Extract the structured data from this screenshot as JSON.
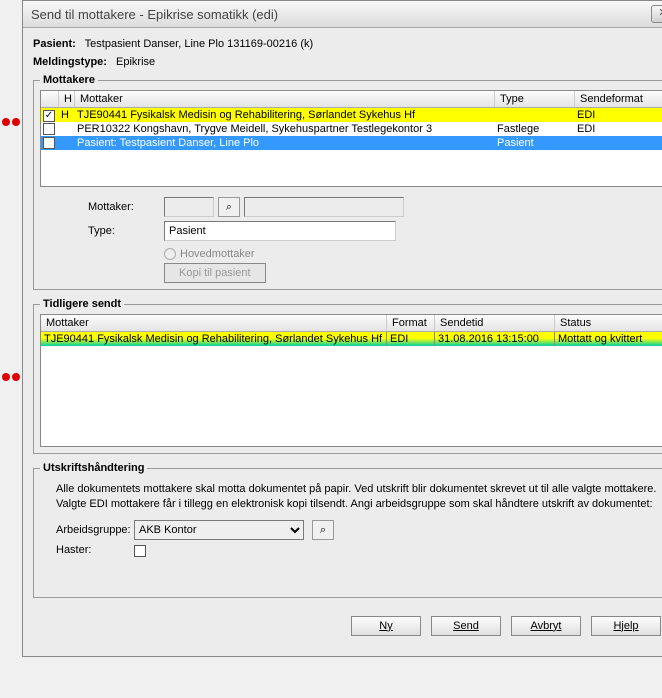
{
  "titlebar": {
    "title": "Send til mottakere - Epikrise somatikk (edi)"
  },
  "patient": {
    "label": "Pasient:",
    "value": "Testpasient Danser, Line Plo  131169-00216 (k)"
  },
  "msgtype": {
    "label": "Meldingstype:",
    "value": "Epikrise"
  },
  "recipients": {
    "legend": "Mottakere",
    "headers": {
      "h": "H",
      "mottaker": "Mottaker",
      "type": "Type",
      "format": "Sendeformat"
    },
    "rows": [
      {
        "checked": true,
        "h": "H",
        "code": "TJE90441",
        "name": "Fysikalsk Medisin og Rehabilitering, Sørlandet Sykehus Hf",
        "type": "",
        "format": "EDI",
        "hl": "yellow"
      },
      {
        "checked": false,
        "h": "",
        "code": "PER10322",
        "name": "Kongshavn, Trygve Meidell, Sykehuspartner Testlegekontor 3",
        "type": "Fastlege",
        "format": "EDI",
        "hl": ""
      },
      {
        "checked": false,
        "h": "",
        "code": "",
        "name": "Pasient: Testpasient Danser, Line Plo",
        "type": "Pasient",
        "format": "",
        "hl": "blue"
      }
    ],
    "form": {
      "mottaker_label": "Mottaker:",
      "type_label": "Type:",
      "type_value": "Pasient",
      "hovedmottaker_label": "Hovedmottaker",
      "kopi_btn": "Kopi til pasient"
    }
  },
  "sent": {
    "legend": "Tidligere sendt",
    "headers": {
      "mottaker": "Mottaker",
      "format": "Format",
      "sendetid": "Sendetid",
      "status": "Status"
    },
    "rows": [
      {
        "code": "TJE90441",
        "name": "Fysikalsk Medisin og Rehabilitering, Sørlandet Sykehus Hf",
        "format": "EDI",
        "time": "31.08.2016 13:15:00",
        "status": "Mottatt og kvittert"
      }
    ]
  },
  "printing": {
    "legend": "Utskriftshåndtering",
    "text": "Alle dokumentets mottakere skal motta dokumentet på papir. Ved utskrift blir dokumentet skrevet ut til alle valgte mottakere. Valgte EDI mottakere får i tillegg en elektronisk kopi tilsendt. Angi arbeidsgruppe som skal håndtere utskrift av dokumentet:",
    "arbeidsgruppe_label": "Arbeidsgruppe:",
    "arbeidsgruppe_value": "AKB Kontor",
    "haster_label": "Haster:"
  },
  "buttons": {
    "ny": "Ny",
    "send": "Send",
    "avbryt": "Avbryt",
    "hjelp": "Hjelp"
  }
}
